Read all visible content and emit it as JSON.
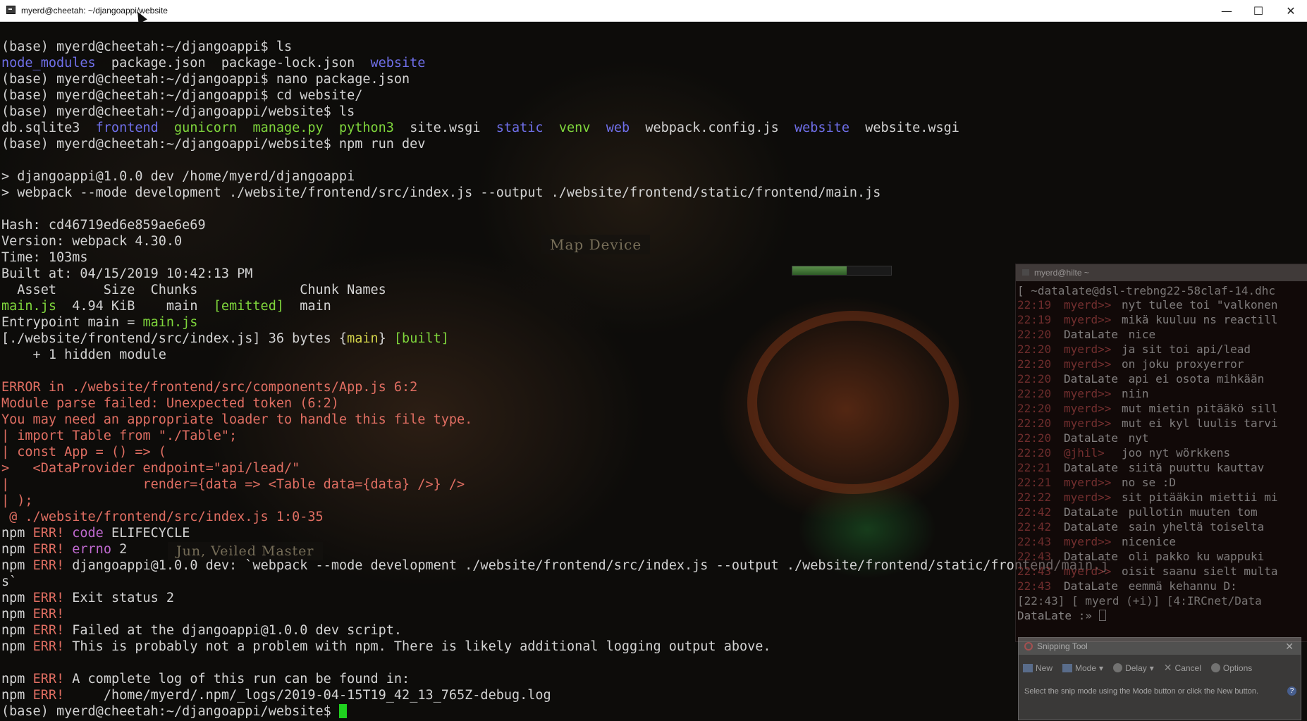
{
  "window": {
    "title": "myerd@cheetah: ~/djangoappi/website",
    "minimize": "—",
    "maximize": "☐",
    "close": "✕"
  },
  "game": {
    "map_device_label": "Map Device",
    "npc_label": "Jun, Veiled Master",
    "health_fraction": 0.55
  },
  "terminal": {
    "lines": [
      [
        {
          "t": "(base) myerd@cheetah:~/djangoappi$ ls",
          "c": "white"
        }
      ],
      [
        {
          "t": "node_modules",
          "c": "blue"
        },
        {
          "t": "  package.json  package-lock.json  ",
          "c": "white"
        },
        {
          "t": "website",
          "c": "blue"
        }
      ],
      [
        {
          "t": "(base) myerd@cheetah:~/djangoappi$ nano package.json",
          "c": "white"
        }
      ],
      [
        {
          "t": "(base) myerd@cheetah:~/djangoappi$ cd website/",
          "c": "white"
        }
      ],
      [
        {
          "t": "(base) myerd@cheetah:~/djangoappi/website$ ls",
          "c": "white"
        }
      ],
      [
        {
          "t": "db.sqlite3  ",
          "c": "white"
        },
        {
          "t": "frontend",
          "c": "blue"
        },
        {
          "t": "  ",
          "c": "white"
        },
        {
          "t": "gunicorn",
          "c": "green"
        },
        {
          "t": "  ",
          "c": "white"
        },
        {
          "t": "manage.py",
          "c": "green"
        },
        {
          "t": "  ",
          "c": "white"
        },
        {
          "t": "python3",
          "c": "green"
        },
        {
          "t": "  site.wsgi  ",
          "c": "white"
        },
        {
          "t": "static",
          "c": "blue"
        },
        {
          "t": "  ",
          "c": "white"
        },
        {
          "t": "venv",
          "c": "green"
        },
        {
          "t": "  ",
          "c": "white"
        },
        {
          "t": "web",
          "c": "blue"
        },
        {
          "t": "  webpack.config.js  ",
          "c": "white"
        },
        {
          "t": "website",
          "c": "blue"
        },
        {
          "t": "  website.wsgi",
          "c": "white"
        }
      ],
      [
        {
          "t": "(base) myerd@cheetah:~/djangoappi/website$ npm run dev",
          "c": "white"
        }
      ],
      [
        {
          "t": "",
          "c": "white"
        }
      ],
      [
        {
          "t": "> djangoappi@1.0.0 dev /home/myerd/djangoappi",
          "c": "white"
        }
      ],
      [
        {
          "t": "> webpack --mode development ./website/frontend/src/index.js --output ./website/frontend/static/frontend/main.js",
          "c": "white"
        }
      ],
      [
        {
          "t": "",
          "c": "white"
        }
      ],
      [
        {
          "t": "Hash: cd46719ed6e859ae6e69",
          "c": "white"
        }
      ],
      [
        {
          "t": "Version: webpack 4.30.0",
          "c": "white"
        }
      ],
      [
        {
          "t": "Time: 103ms",
          "c": "white"
        }
      ],
      [
        {
          "t": "Built at: 04/15/2019 10:42:13 PM",
          "c": "white"
        }
      ],
      [
        {
          "t": "  Asset      Size  Chunks             Chunk Names",
          "c": "white"
        }
      ],
      [
        {
          "t": "main.js",
          "c": "green"
        },
        {
          "t": "  4.94 KiB    main  ",
          "c": "white"
        },
        {
          "t": "[emitted]",
          "c": "green"
        },
        {
          "t": "  main",
          "c": "white"
        }
      ],
      [
        {
          "t": "Entrypoint main = ",
          "c": "white"
        },
        {
          "t": "main.js",
          "c": "green"
        }
      ],
      [
        {
          "t": "[./website/frontend/src/index.js] 36 bytes {",
          "c": "white"
        },
        {
          "t": "main",
          "c": "yellow"
        },
        {
          "t": "} ",
          "c": "white"
        },
        {
          "t": "[built]",
          "c": "green"
        }
      ],
      [
        {
          "t": "    + 1 hidden module",
          "c": "white"
        }
      ],
      [
        {
          "t": "",
          "c": "white"
        }
      ],
      [
        {
          "t": "ERROR in ./website/frontend/src/components/App.js 6:2",
          "c": "red"
        }
      ],
      [
        {
          "t": "Module parse failed: Unexpected token (6:2)",
          "c": "red"
        }
      ],
      [
        {
          "t": "You may need an appropriate loader to handle this file type.",
          "c": "red"
        }
      ],
      [
        {
          "t": "| import Table from \"./Table\";",
          "c": "red"
        }
      ],
      [
        {
          "t": "| const App = () => (",
          "c": "red"
        }
      ],
      [
        {
          "t": ">   <DataProvider endpoint=\"api/lead/\"",
          "c": "red"
        }
      ],
      [
        {
          "t": "|                 render={data => <Table data={data} />} />",
          "c": "red"
        }
      ],
      [
        {
          "t": "| );",
          "c": "red"
        }
      ],
      [
        {
          "t": " @ ./website/frontend/src/index.js 1:0-35",
          "c": "red"
        }
      ],
      [
        {
          "t": "npm ",
          "c": "white"
        },
        {
          "t": "ERR!",
          "c": "red"
        },
        {
          "t": " ",
          "c": "white"
        },
        {
          "t": "code",
          "c": "magenta"
        },
        {
          "t": " ELIFECYCLE",
          "c": "white"
        }
      ],
      [
        {
          "t": "npm ",
          "c": "white"
        },
        {
          "t": "ERR!",
          "c": "red"
        },
        {
          "t": " ",
          "c": "white"
        },
        {
          "t": "errno",
          "c": "magenta"
        },
        {
          "t": " 2",
          "c": "white"
        }
      ],
      [
        {
          "t": "npm ",
          "c": "white"
        },
        {
          "t": "ERR!",
          "c": "red"
        },
        {
          "t": " djangoappi@1.0.0 dev: `webpack --mode development ./website/frontend/src/index.js --output ./website/frontend/static/frontend/main.j",
          "c": "white"
        }
      ],
      [
        {
          "t": "s`",
          "c": "white"
        }
      ],
      [
        {
          "t": "npm ",
          "c": "white"
        },
        {
          "t": "ERR!",
          "c": "red"
        },
        {
          "t": " Exit status 2",
          "c": "white"
        }
      ],
      [
        {
          "t": "npm ",
          "c": "white"
        },
        {
          "t": "ERR!",
          "c": "red"
        }
      ],
      [
        {
          "t": "npm ",
          "c": "white"
        },
        {
          "t": "ERR!",
          "c": "red"
        },
        {
          "t": " Failed at the djangoappi@1.0.0 dev script.",
          "c": "white"
        }
      ],
      [
        {
          "t": "npm ",
          "c": "white"
        },
        {
          "t": "ERR!",
          "c": "red"
        },
        {
          "t": " This is probably not a problem with npm. There is likely additional logging output above.",
          "c": "white"
        }
      ],
      [
        {
          "t": "",
          "c": "white"
        }
      ],
      [
        {
          "t": "npm ",
          "c": "white"
        },
        {
          "t": "ERR!",
          "c": "red"
        },
        {
          "t": " A complete log of this run can be found in:",
          "c": "white"
        }
      ],
      [
        {
          "t": "npm ",
          "c": "white"
        },
        {
          "t": "ERR!",
          "c": "red"
        },
        {
          "t": "     /home/myerd/.npm/_logs/2019-04-15T19_42_13_765Z-debug.log",
          "c": "white"
        }
      ],
      [
        {
          "t": "(base) myerd@cheetah:~/djangoappi/website$ ",
          "c": "white"
        }
      ]
    ]
  },
  "irc": {
    "window_title": "myerd@hilte ~",
    "header": "[ ~datalate@dsl-trebng22-58claf-14.dhc",
    "rows": [
      {
        "time": "22:19",
        "nick": "myerd>>",
        "text": "nyt tulee toi \"valkonen",
        "self": true
      },
      {
        "time": "22:19",
        "nick": "myerd>>",
        "text": "mikä kuuluu ns reactill",
        "self": true
      },
      {
        "time": "22:20",
        "nick": "DataLate",
        "text": " nice",
        "self": false
      },
      {
        "time": "22:20",
        "nick": "myerd>>",
        "text": "ja sit toi api/lead",
        "self": true
      },
      {
        "time": "22:20",
        "nick": "myerd>>",
        "text": "on joku proxyerror",
        "self": true
      },
      {
        "time": "22:20",
        "nick": "DataLate",
        "text": " api ei osota mihkään",
        "self": false
      },
      {
        "time": "22:20",
        "nick": "myerd>>",
        "text": "niin",
        "self": true
      },
      {
        "time": "22:20",
        "nick": "myerd>>",
        "text": "mut mietin pitääkö sill",
        "self": true
      },
      {
        "time": "22:20",
        "nick": "myerd>>",
        "text": "mut ei kyl luulis tarvi",
        "self": true
      },
      {
        "time": "22:20",
        "nick": "DataLate",
        "text": " nyt",
        "self": false
      },
      {
        "time": "22:20",
        "nick": "@jhil>",
        "text": "joo nyt wörkkens",
        "self": true
      },
      {
        "time": "22:21",
        "nick": "DataLate",
        "text": " siitä puuttu kauttav",
        "self": false
      },
      {
        "time": "22:21",
        "nick": "myerd>>",
        "text": "no se :D",
        "self": true
      },
      {
        "time": "22:22",
        "nick": "myerd>>",
        "text": "sit pitääkin miettii mi",
        "self": true
      },
      {
        "time": "22:42",
        "nick": "DataLate",
        "text": " pullotin muuten tom",
        "self": false
      },
      {
        "time": "22:42",
        "nick": "DataLate",
        "text": " sain yheltä toiselta",
        "self": false
      },
      {
        "time": "22:43",
        "nick": "myerd>>",
        "text": "nicenice",
        "self": true
      },
      {
        "time": "22:43",
        "nick": "DataLate",
        "text": " oli pakko ku wappuki",
        "self": false
      },
      {
        "time": "22:43",
        "nick": "myerd>>",
        "text": "oisit saanu sielt multa",
        "self": true
      },
      {
        "time": "22:43",
        "nick": "DataLate",
        "text": " eemmä kehannu D:",
        "self": false
      }
    ],
    "status": "[22:43] [ myerd (+i)] [4:IRCnet/Data",
    "input_prompt": "DataLate"
  },
  "snipping_tool": {
    "title": "Snipping Tool",
    "close": "✕",
    "new_label": "New",
    "mode_label": "Mode",
    "delay_label": "Delay",
    "cancel_label": "Cancel",
    "options_label": "Options",
    "help_text": "Select the snip mode using the Mode button or click the New button.",
    "help_icon": "?"
  }
}
